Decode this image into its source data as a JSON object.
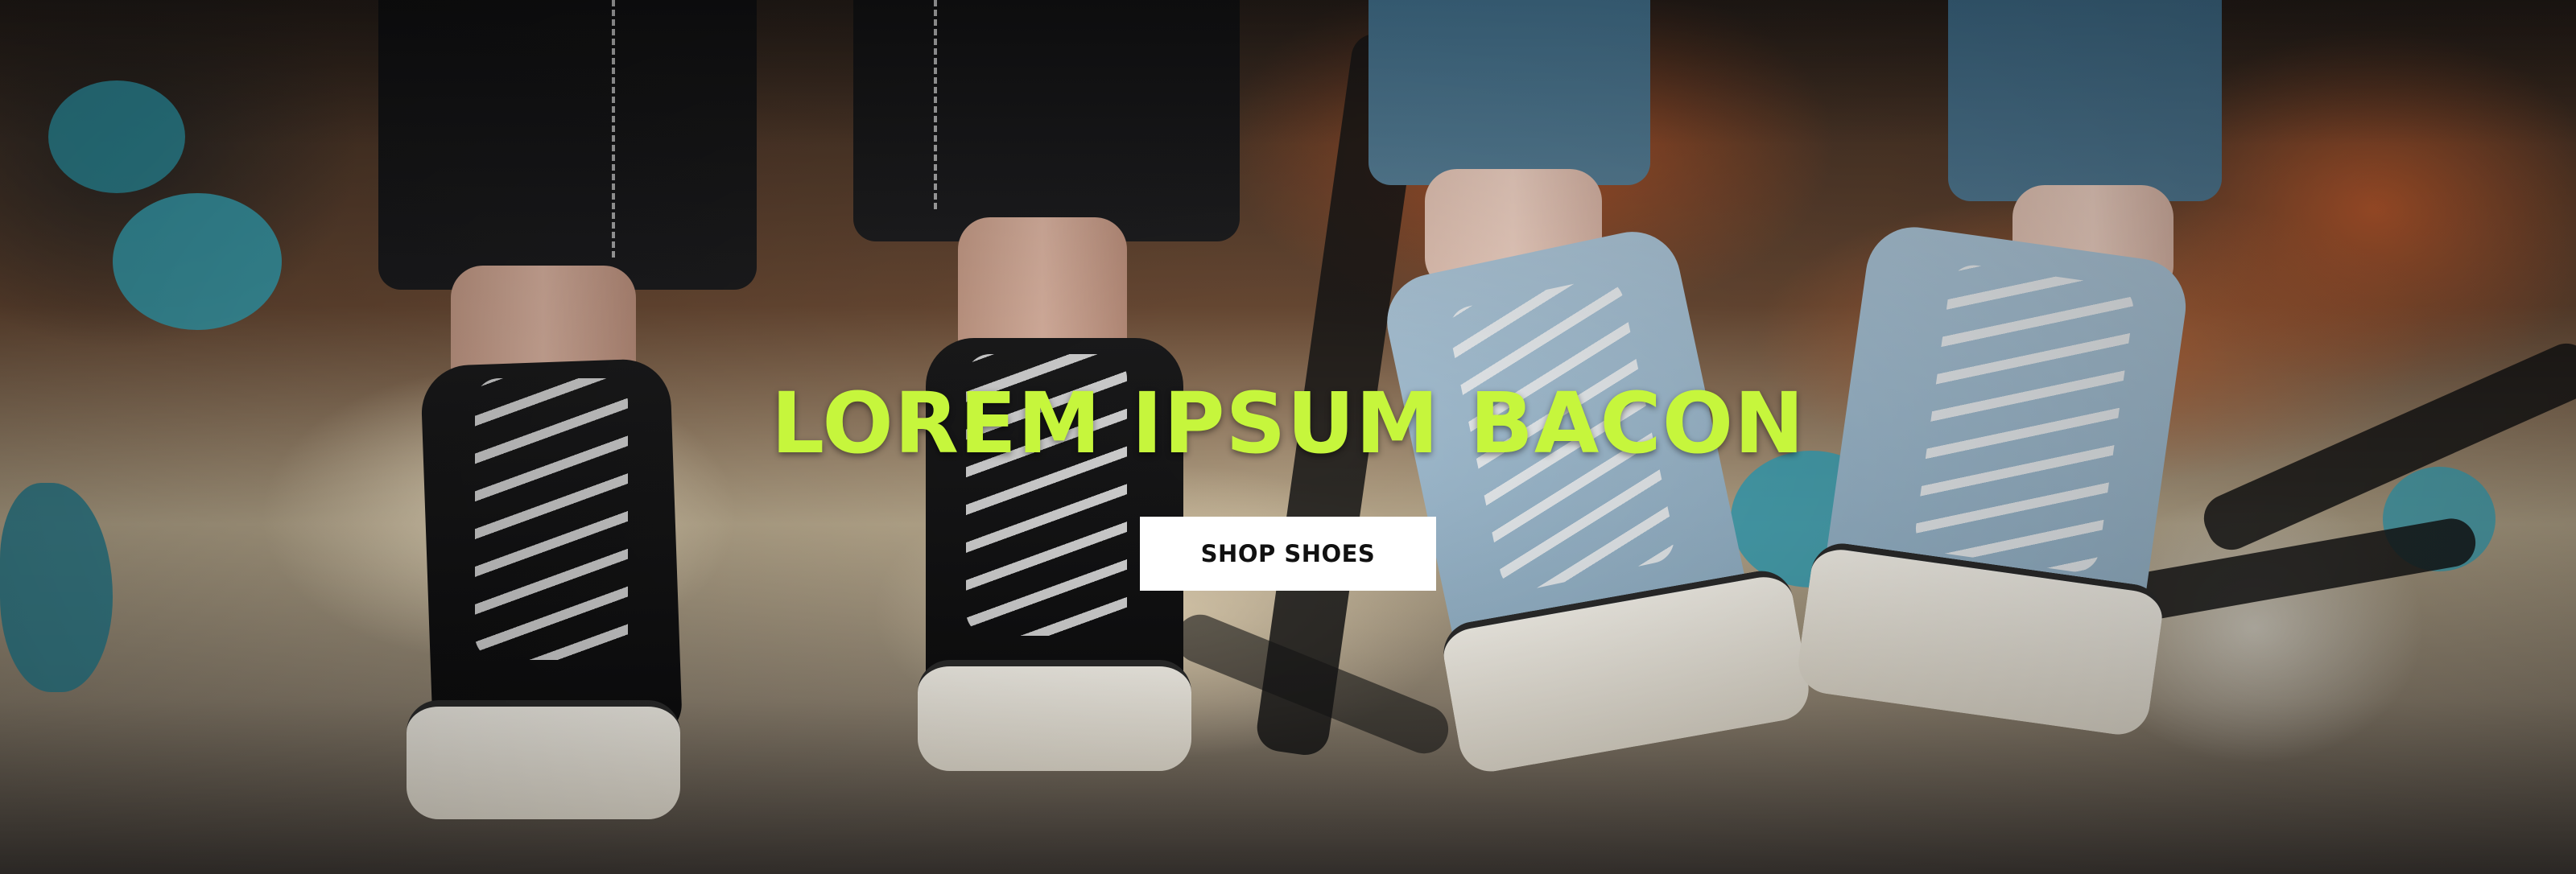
{
  "hero": {
    "headline": "LOREM IPSUM BACON",
    "cta_label": "SHOP SHOES",
    "headline_color": "#c6f63c",
    "cta_background": "#ffffff",
    "cta_text_color": "#111111"
  }
}
